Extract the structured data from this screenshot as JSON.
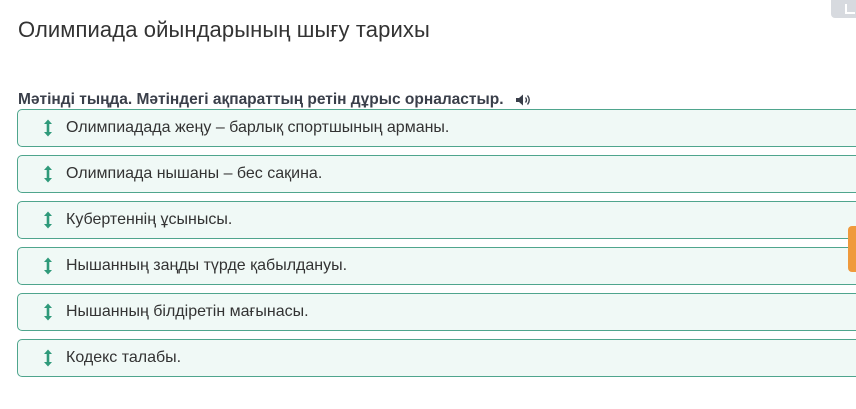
{
  "page": {
    "title": "Олимпиада ойындарының шығу тарихы"
  },
  "task": {
    "instruction": "Мәтінді тыңда. Мәтіндегі ақпараттың ретін дұрыс орналастыр.",
    "speaker_icon": "speaker-icon"
  },
  "items": [
    {
      "label": "Олимпиадада жеңу – барлық спортшының арманы.",
      "icon": "drag-updown-icon"
    },
    {
      "label": "Олимпиада нышаны – бес сақина.",
      "icon": "drag-updown-icon"
    },
    {
      "label": "Кубертеннің ұсынысы.",
      "icon": "drag-updown-icon"
    },
    {
      "label": "Нышанның заңды түрде қабылдануы.",
      "icon": "drag-updown-icon"
    },
    {
      "label": "Нышанның білдіретін мағынасы.",
      "icon": "drag-updown-icon"
    },
    {
      "label": "Кодекс талабы.",
      "icon": "drag-updown-icon"
    }
  ],
  "colors": {
    "item_border": "#4fa58d",
    "item_background": "#f0f9f6",
    "drag_icon": "#2f9a7a",
    "side_tab": "#ef9a3c"
  }
}
